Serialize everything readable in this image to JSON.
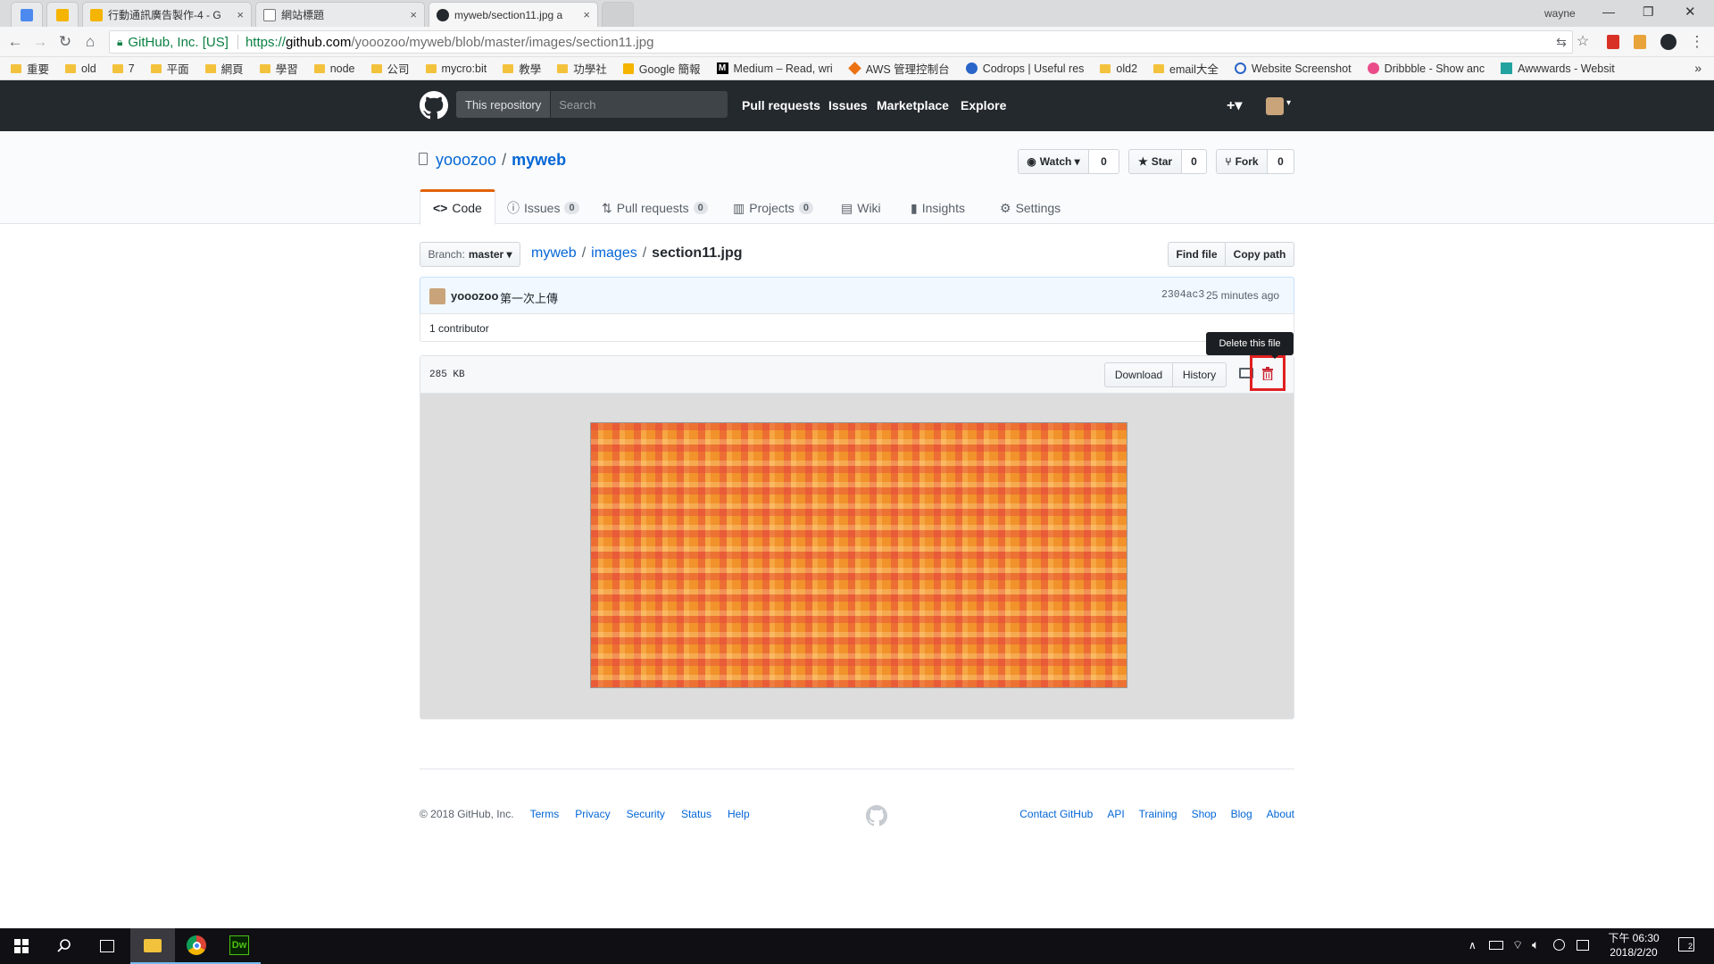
{
  "browser": {
    "tabs": [
      {
        "title": "",
        "icon": "google-docs-icon",
        "close": ""
      },
      {
        "title": "",
        "icon": "google-slides-icon",
        "close": ""
      },
      {
        "title": "行動通訊廣告製作-4 - G",
        "icon": "google-slides-icon",
        "close": "×"
      },
      {
        "title": "網站標題",
        "icon": "page-icon",
        "close": "×"
      },
      {
        "title": "myweb/section11.jpg a",
        "icon": "github-icon",
        "close": "×"
      }
    ],
    "user": "wayne",
    "window_controls": [
      "—",
      "❐",
      "✕"
    ],
    "secure_label": "GitHub, Inc. [US]",
    "url_scheme": "https://",
    "url_host": "github.com",
    "url_path": "/yooozoo/myweb/blob/master/images/section11.jpg",
    "bookmarks": [
      {
        "label": "重要",
        "icon": "folder-icon"
      },
      {
        "label": "old",
        "icon": "folder-icon"
      },
      {
        "label": "7",
        "icon": "folder-icon"
      },
      {
        "label": "平面",
        "icon": "folder-icon"
      },
      {
        "label": "網頁",
        "icon": "folder-icon"
      },
      {
        "label": "學習",
        "icon": "folder-icon"
      },
      {
        "label": "node",
        "icon": "folder-icon"
      },
      {
        "label": "公司",
        "icon": "folder-icon"
      },
      {
        "label": "mycro:bit",
        "icon": "folder-icon"
      },
      {
        "label": "教學",
        "icon": "folder-icon"
      },
      {
        "label": "功學社",
        "icon": "folder-icon"
      },
      {
        "label": "Google 簡報",
        "icon": "slides-icon"
      },
      {
        "label": "Medium – Read, wri",
        "icon": "medium-icon"
      },
      {
        "label": "AWS 管理控制台",
        "icon": "aws-icon"
      },
      {
        "label": "Codrops | Useful res",
        "icon": "codrops-icon"
      },
      {
        "label": "old2",
        "icon": "folder-icon"
      },
      {
        "label": "email大全",
        "icon": "folder-icon"
      },
      {
        "label": "Website Screenshot",
        "icon": "globe-icon"
      },
      {
        "label": "Dribbble - Show anc",
        "icon": "dribbble-icon"
      },
      {
        "label": "Awwwards - Websit",
        "icon": "awwwards-icon"
      }
    ],
    "more_bookmarks": "»"
  },
  "github": {
    "search_scope": "This repository",
    "search_placeholder": "Search",
    "nav": [
      "Pull requests",
      "Issues",
      "Marketplace",
      "Explore"
    ],
    "plus": "+▾",
    "owner": "yooozoo",
    "sep": "/",
    "repo": "myweb",
    "watch_label": "Watch ▾",
    "watch_count": "0",
    "star_label": "Star",
    "star_count": "0",
    "fork_label": "Fork",
    "fork_count": "0",
    "tabs": {
      "code": "Code",
      "issues": "Issues",
      "issues_count": "0",
      "pulls": "Pull requests",
      "pulls_count": "0",
      "projects": "Projects",
      "projects_count": "0",
      "wiki": "Wiki",
      "insights": "Insights",
      "settings": "Settings"
    },
    "branch_label": "Branch:",
    "branch_name": "master ▾",
    "crumb_repo": "myweb",
    "crumb_dir": "images",
    "crumb_file": "section11.jpg",
    "find_file": "Find file",
    "copy_path": "Copy path",
    "commit_author": "yooozoo",
    "commit_message": "第一次上傳",
    "commit_sha": "2304ac3",
    "commit_time": "25 minutes ago",
    "contributors": "1 contributor",
    "file_size": "285 KB",
    "download": "Download",
    "history": "History",
    "delete_tooltip": "Delete this file"
  },
  "footer": {
    "copyright": "© 2018 GitHub, Inc.",
    "left_links": [
      "Terms",
      "Privacy",
      "Security",
      "Status",
      "Help"
    ],
    "right_links": [
      "Contact GitHub",
      "API",
      "Training",
      "Shop",
      "Blog",
      "About"
    ]
  },
  "taskbar": {
    "time": "下午 06:30",
    "date": "2018/2/20",
    "notification_count": "2",
    "dw_label": "Dw"
  },
  "colors": {
    "gh_header": "#24292e",
    "link_blue": "#0366d6",
    "tab_accent": "#e36209",
    "highlight_red": "#e02020",
    "plaid_orange": "#f59a2a"
  }
}
